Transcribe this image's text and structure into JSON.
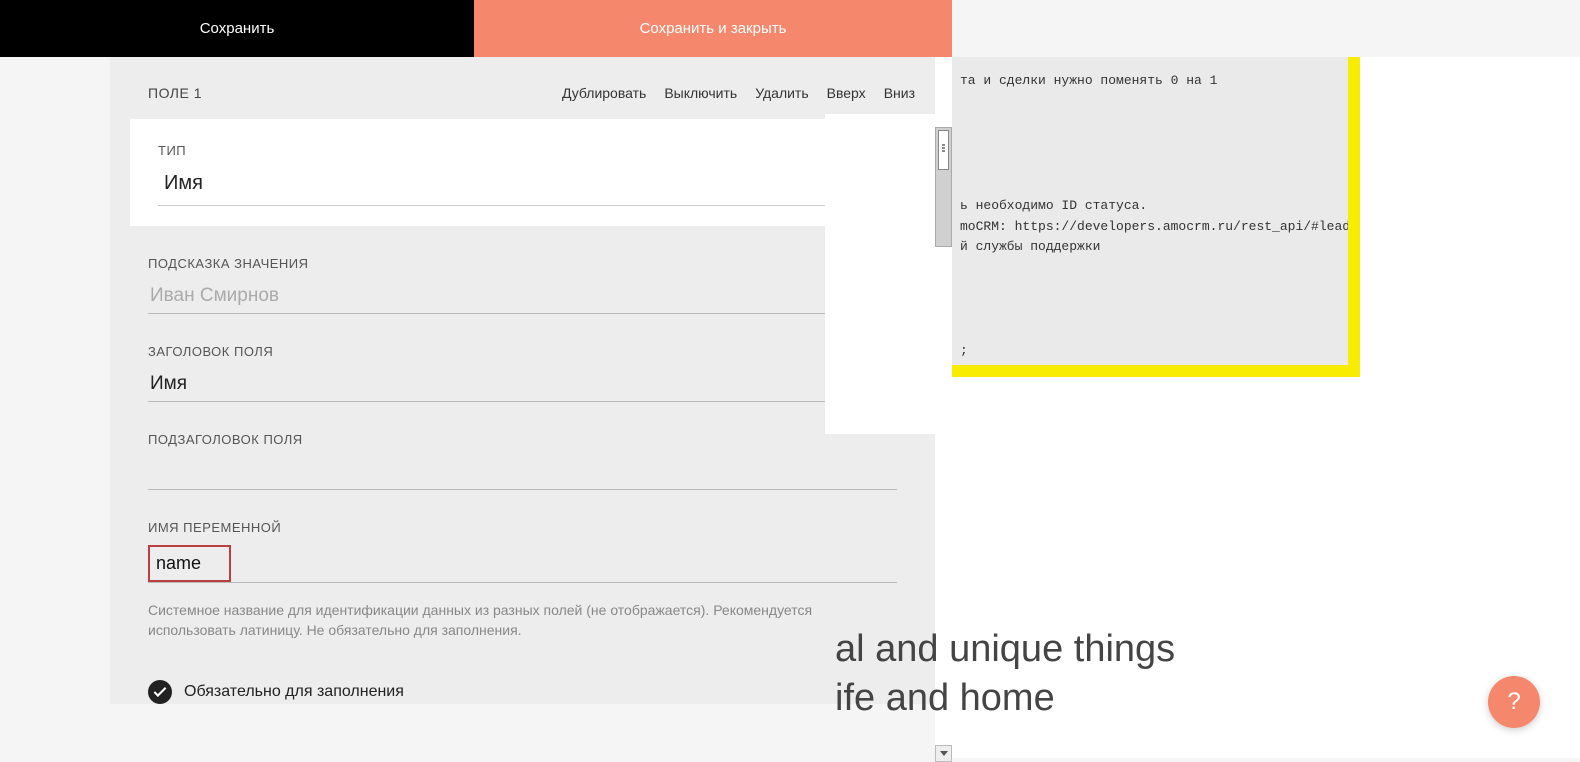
{
  "header": {
    "save_label": "Сохранить",
    "save_close_label": "Сохранить и закрыть"
  },
  "field": {
    "title": "ПОЛЕ 1",
    "actions": {
      "duplicate": "Дублировать",
      "disable": "Выключить",
      "delete": "Удалить",
      "up": "Вверх",
      "down": "Вниз"
    },
    "type_label": "ТИП",
    "type_value": "Имя",
    "hint_label": "ПОДСКАЗКА ЗНАЧЕНИЯ",
    "hint_placeholder": "Иван Смирнов",
    "hint_value": "",
    "title_label": "ЗАГОЛОВОК ПОЛЯ",
    "title_value": "Имя",
    "subtitle_label": "ПОДЗАГОЛОВОК ПОЛЯ",
    "subtitle_value": "",
    "var_label": "ИМЯ ПЕРЕМЕННОЙ",
    "var_value": "name",
    "var_hint": "Системное название для идентификации данных из разных полей (не отображается). Рекомендуется использовать латиницу. Не обязательно для заполнения.",
    "required_label": "Обязательно для заполнения",
    "required_checked": true
  },
  "code": {
    "lines": "та и сделки нужно поменять 0 на 1\n\n\n\n\n\nь необходимо ID статуса.\nmoCRM: https://developers.amocrm.ru/rest_api/#lead\nй службы поддержки\n\n\n\n\n;"
  },
  "background": {
    "line1": "al and unique things",
    "line2": "ife and home"
  },
  "help_icon": "?"
}
